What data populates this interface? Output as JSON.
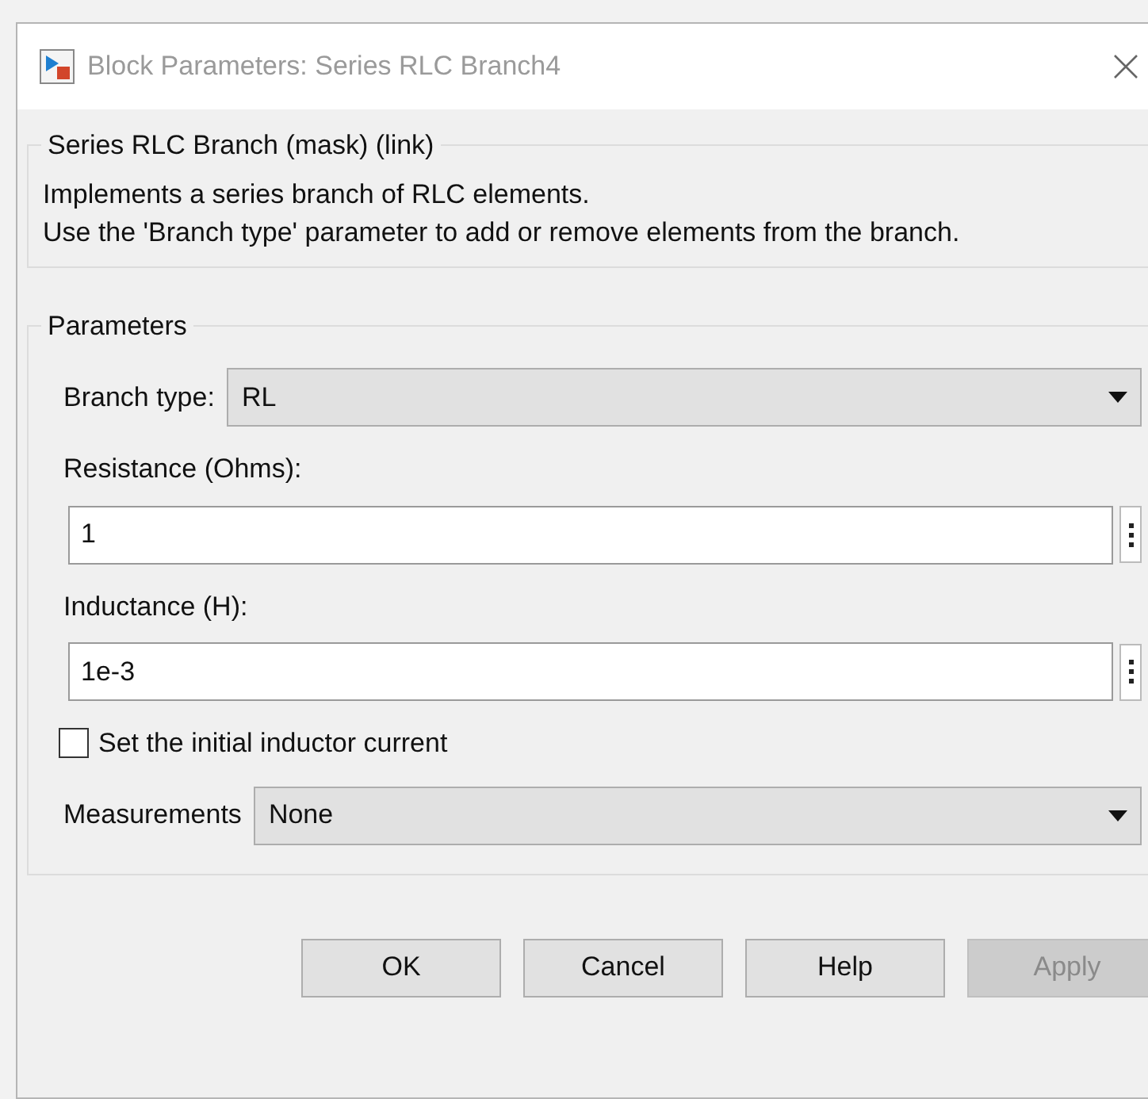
{
  "window": {
    "title": "Block Parameters: Series RLC Branch4"
  },
  "description_group": {
    "title": "Series RLC Branch (mask) (link)",
    "lines": [
      "Implements a series branch of RLC elements.",
      "Use the 'Branch type' parameter to add or remove elements from the branch."
    ]
  },
  "parameters_group": {
    "title": "Parameters",
    "fields": [
      {
        "kind": "dropdown",
        "label": "Branch type:",
        "value": "RL"
      },
      {
        "kind": "text",
        "label": "Resistance (Ohms):",
        "value": "1"
      },
      {
        "kind": "text",
        "label": "Inductance (H):",
        "value": "1e-3"
      },
      {
        "kind": "checkbox",
        "label": "Set the initial inductor current",
        "checked": false
      },
      {
        "kind": "dropdown",
        "label": "Measurements",
        "value": "None"
      }
    ]
  },
  "buttons": [
    {
      "label": "OK",
      "disabled": false
    },
    {
      "label": "Cancel",
      "disabled": false
    },
    {
      "label": "Help",
      "disabled": false
    },
    {
      "label": "Apply",
      "disabled": true
    }
  ]
}
